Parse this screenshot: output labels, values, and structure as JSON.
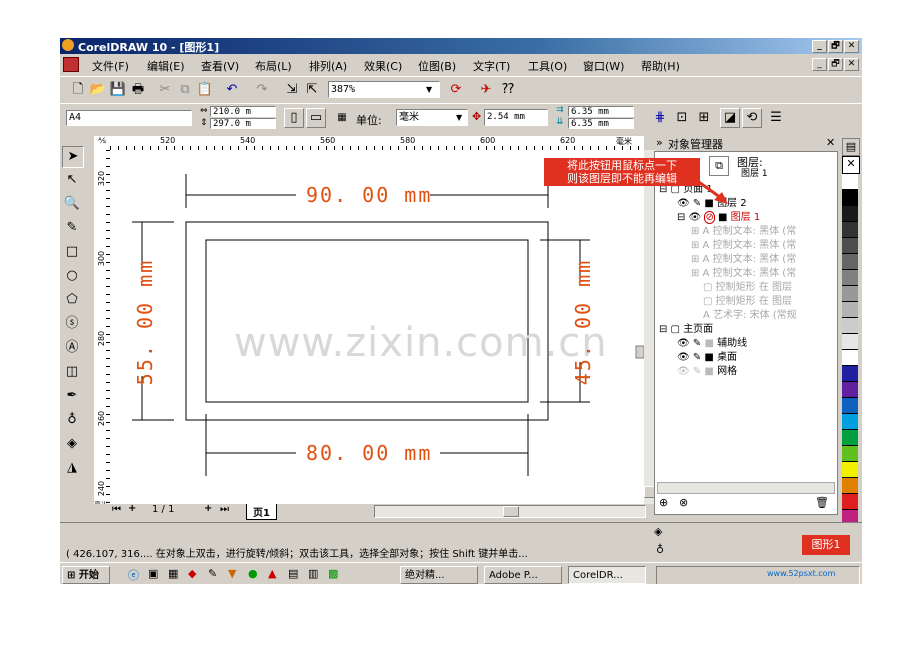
{
  "window": {
    "title": "CorelDRAW 10 - [图形1]",
    "controls": [
      "_",
      "🗗",
      "✕"
    ]
  },
  "menu": [
    "文件(F)",
    "编辑(E)",
    "查看(V)",
    "布局(L)",
    "排列(A)",
    "效果(C)",
    "位图(B)",
    "文字(T)",
    "工具(O)",
    "窗口(W)",
    "帮助(H)"
  ],
  "toolbar": {
    "zoom": "387%"
  },
  "propbar": {
    "paper": "A4",
    "width": "210.0 m",
    "height": "297.0 m",
    "unit_label": "单位:",
    "unit": "毫米",
    "nudge": "2.54 mm",
    "dup_x": "6.35 mm",
    "dup_y": "6.35 mm"
  },
  "ruler": {
    "h_ticks": [
      "520",
      "540",
      "560",
      "580",
      "600",
      "620"
    ],
    "h_unit": "毫米",
    "v_ticks": [
      "320",
      "300",
      "280",
      "260",
      "240"
    ],
    "v_unit": "毫米"
  },
  "drawing": {
    "dim_top": "90. 00 mm",
    "dim_bottom": "80. 00 mm",
    "dim_left": "55. 00 mm",
    "dim_right": "45. 00 mm",
    "watermark": "www.zixin.com.cn"
  },
  "pages": {
    "counter": "1 / 1",
    "tab": "页1"
  },
  "object_manager": {
    "title": "对象管理器",
    "header_layer": "图层:",
    "header_sub": "图层 1",
    "tooltip": "将此按钮用鼠标点一下\n则该图层即不能再编辑",
    "tree": [
      {
        "label": "页面 1",
        "level": 0,
        "gray": false
      },
      {
        "label": "图层 2",
        "level": 1,
        "gray": false
      },
      {
        "label": "图层 1",
        "level": 1,
        "gray": false,
        "red": true
      },
      {
        "label": "控制文本: 黑体 (常",
        "level": 2,
        "gray": true
      },
      {
        "label": "控制文本: 黑体 (常",
        "level": 2,
        "gray": true
      },
      {
        "label": "控制文本: 黑体 (常",
        "level": 2,
        "gray": true
      },
      {
        "label": "控制文本: 黑体 (常",
        "level": 2,
        "gray": true
      },
      {
        "label": "控制矩形 在 图层",
        "level": 2,
        "gray": true
      },
      {
        "label": "控制矩形 在 图层",
        "level": 2,
        "gray": true
      },
      {
        "label": "艺术字: 宋体 (常规",
        "level": 2,
        "gray": true
      },
      {
        "label": "主页面",
        "level": 0,
        "gray": false
      },
      {
        "label": "辅助线",
        "level": 1,
        "gray": false
      },
      {
        "label": "桌面",
        "level": 1,
        "gray": false
      },
      {
        "label": "网格",
        "level": 1,
        "gray": false
      }
    ]
  },
  "status": {
    "text": "( 426.107, 316.... 在对象上双击，进行旋转/倾斜；双击该工具，选择全部对象；按住 Shift 键并单击...",
    "doc": "图形1"
  },
  "taskbar": {
    "start": "开始",
    "tasks": [
      "绝对精...",
      "Adobe P...",
      "CorelDR..."
    ],
    "tray": "www.52psxt.com"
  },
  "palette": [
    "#ffffff",
    "#000000",
    "#1a1a1a",
    "#333333",
    "#4d4d4d",
    "#666666",
    "#808080",
    "#999999",
    "#b3b3b3",
    "#cccccc",
    "#e6e6e6",
    "#ffffff",
    "#2020a0",
    "#6020a0",
    "#1060c0",
    "#00a0e0",
    "#00a040",
    "#60c020",
    "#f0f000",
    "#e08000",
    "#e02020",
    "#c02080",
    "#a02060",
    "#d07020"
  ]
}
